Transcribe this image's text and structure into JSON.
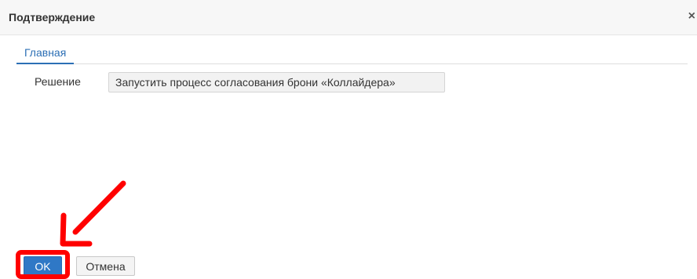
{
  "dialog": {
    "title": "Подтверждение",
    "close_icon": "close-icon"
  },
  "tabs": [
    {
      "label": "Главная",
      "active": true
    }
  ],
  "form": {
    "decision_label": "Решение",
    "decision_value": "Запустить процесс согласования брони «Коллайдера»"
  },
  "footer": {
    "ok_label": "OK",
    "cancel_label": "Отмена"
  },
  "annotation": {
    "type": "arrow",
    "target": "ok-button",
    "color": "#ff0000"
  },
  "colors": {
    "accent": "#2c6fb5",
    "primary_button": "#2f78c6",
    "highlight": "#ff0000",
    "header_bg": "#f7f7f7",
    "input_bg": "#f2f2f2"
  }
}
